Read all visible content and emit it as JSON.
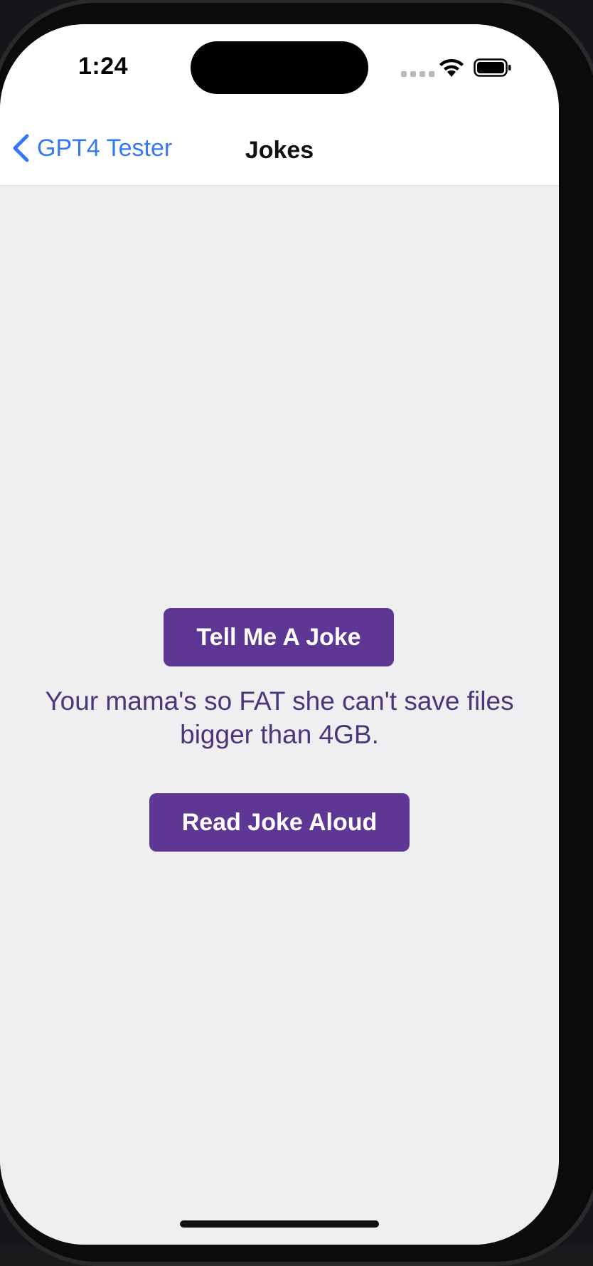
{
  "status_bar": {
    "time": "1:24"
  },
  "nav": {
    "back_label": "GPT4 Tester",
    "title": "Jokes"
  },
  "main": {
    "tell_joke_label": "Tell Me A Joke",
    "joke_text": "Your mama's so FAT she can't save files bigger than 4GB.",
    "read_aloud_label": "Read Joke Aloud"
  },
  "colors": {
    "accent_button": "#5e3693",
    "joke_text": "#4a3678",
    "link_blue": "#3478f6",
    "background": "#efeef0"
  },
  "icons": {
    "back": "chevron-left-icon",
    "wifi": "wifi-icon",
    "battery": "battery-icon",
    "cellular": "cellular-dots-icon"
  }
}
